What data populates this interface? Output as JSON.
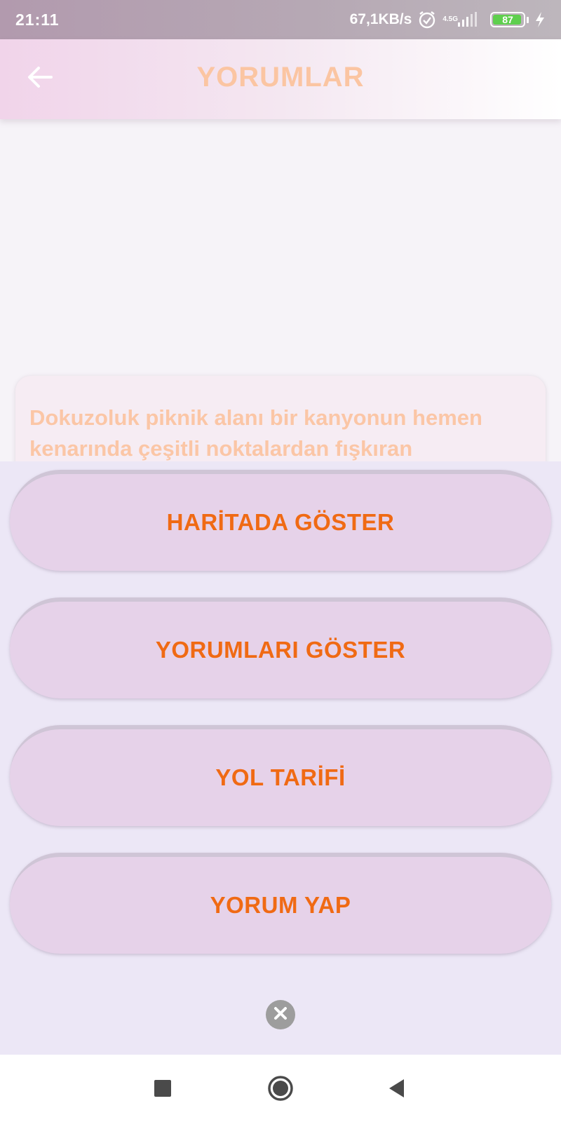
{
  "status_bar": {
    "time": "21:11",
    "network_speed": "67,1KB/s",
    "network_type": "4.5G",
    "battery_level": "87",
    "icons": [
      "alarm-icon",
      "signal-icon",
      "battery-icon",
      "charging-icon"
    ]
  },
  "app_bar": {
    "title": "YORUMLAR",
    "back_icon": "arrow-back-icon"
  },
  "content": {
    "description": "Dokuzoluk piknik alanı bir kanyonun hemen kenarında çeşitli noktalardan fışkıran"
  },
  "sheet": {
    "buttons": [
      {
        "label": "HARİTADA GÖSTER"
      },
      {
        "label": "YORUMLARI GÖSTER"
      },
      {
        "label": "YOL TARİFİ"
      },
      {
        "label": "YORUM YAP"
      }
    ],
    "close_icon": "close-icon"
  },
  "nav_bar": {
    "icons": [
      "recent-apps-icon",
      "home-icon",
      "back-icon"
    ]
  },
  "colors": {
    "accent_text": "#f06a14",
    "title_color": "#fbc5a2",
    "button_bg": "#e6d2e9",
    "sheet_bg": "#ece7f6"
  }
}
